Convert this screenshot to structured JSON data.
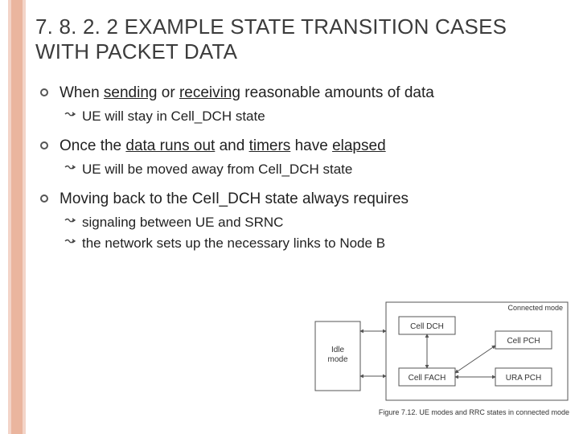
{
  "title": "7. 8. 2. 2 EXAMPLE STATE TRANSITION CASES WITH PACKET DATA",
  "bullets": [
    {
      "segments": [
        {
          "t": "When "
        },
        {
          "t": "sending",
          "u": true
        },
        {
          "t": " or "
        },
        {
          "t": "receiving",
          "u": true
        },
        {
          "t": " reasonable amounts of data"
        }
      ],
      "sub": [
        {
          "segments": [
            {
              "t": "UE will stay in Cell_DCH state"
            }
          ]
        }
      ]
    },
    {
      "segments": [
        {
          "t": "Once the "
        },
        {
          "t": "data runs out",
          "u": true
        },
        {
          "t": " and "
        },
        {
          "t": "timers",
          "u": true
        },
        {
          "t": " have "
        },
        {
          "t": "elapsed",
          "u": true
        }
      ],
      "sub": [
        {
          "segments": [
            {
              "t": "UE will be moved away from Cell_DCH state"
            }
          ]
        }
      ]
    },
    {
      "segments": [
        {
          "t": "Moving back to the CeIl_DCH state always requires"
        }
      ],
      "sub": [
        {
          "segments": [
            {
              "t": "signaling between UE and SRNC"
            }
          ]
        },
        {
          "segments": [
            {
              "t": "the network sets up the necessary links to Node B"
            }
          ]
        }
      ]
    }
  ],
  "diagram": {
    "idle_label": "Idle\nmode",
    "connected_label": "Connected mode",
    "states": {
      "cell_dch": "Cell DCH",
      "cell_fach": "Cell FACH",
      "cell_pch": "Cell PCH",
      "ura_pch": "URA PCH"
    },
    "caption": "Figure 7.12.  UE modes and RRC states in connected mode"
  }
}
